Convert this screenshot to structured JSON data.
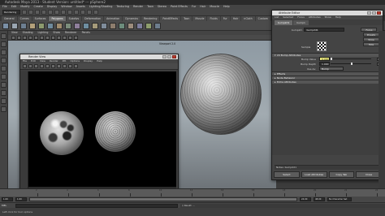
{
  "app": {
    "title": "Autodesk Maya 2013 - Student Version: untitled* --- pSphere2",
    "menus": [
      "File",
      "Edit",
      "Modify",
      "Create",
      "Display",
      "Window",
      "Assets",
      "Lighting/Shading",
      "Texturing",
      "Render",
      "Toon",
      "Stereo",
      "Paint Effects",
      "Fur",
      "Hair",
      "Muscle",
      "Help"
    ]
  },
  "status_line": {
    "mode_selector": "Rendering"
  },
  "shelf": {
    "tabs": [
      "General",
      "Curves",
      "Surfaces",
      "Polygons",
      "Subdivs",
      "Deformation",
      "Animation",
      "Dynamics",
      "Rendering",
      "PaintEffects",
      "Toon",
      "Muscle",
      "Fluids",
      "Fur",
      "Hair",
      "nCloth",
      "Custom"
    ],
    "active_tab": "Polygons",
    "icon_colors": [
      "#7a8fa5",
      "#9aa6b2",
      "#6d7f91",
      "#b3a07a",
      "#8c9a6e",
      "#6f8a9c",
      "#a08c6e",
      "#7b8d7b",
      "#8f7f9b",
      "#6e8ea0",
      "#a59a7a",
      "#7f8c9a",
      "#8d7d6d",
      "#6c8c7c",
      "#9c8c7c",
      "#7d7d9d",
      "#8d9d6d",
      "#6d7d8d"
    ]
  },
  "viewport": {
    "menu": [
      "View",
      "Shading",
      "Lighting",
      "Show",
      "Renderer",
      "Panels"
    ],
    "label": "Viewport 2.0"
  },
  "render_view": {
    "title": "Render View",
    "menu": [
      "File",
      "Edit",
      "View",
      "Render",
      "IPR",
      "Options",
      "Display",
      "Help"
    ],
    "info_line1": "size: 640 x 480  zoom: 1.000      (mental ray)",
    "frame_label": "Frame: 1",
    "render_time_label": "Render Time: 0:01",
    "camera_label": "Camera: persp"
  },
  "attribute_editor": {
    "title": "Attribute Editor",
    "menu": [
      "List",
      "Selected",
      "Focus",
      "Attributes",
      "Show",
      "Help"
    ],
    "tabs": [
      "bump2d1",
      "bump1"
    ],
    "active_tab": "bump2d1",
    "node_type_label": "bump2d:",
    "node_name": "bump2d1",
    "focus_button": "Focus",
    "presets_button": "Presets",
    "show_button": "Show",
    "hide_button": "Hide",
    "sample_label": "Sample",
    "sections": {
      "bump_attributes": "2d Bump Attributes",
      "effects": "Effects",
      "node_behavior": "Node Behavior",
      "extra_attributes": "Extra Attributes"
    },
    "attrs": {
      "bump_value_label": "Bump Value",
      "bump_value": "0.000",
      "bump_depth_label": "Bump Depth",
      "bump_depth": "1.000",
      "use_as_label": "Use As:",
      "use_as_value": "Bump"
    },
    "notes_label": "Notes:  bump2d1",
    "bottom_buttons": [
      "Select",
      "Load Attributes",
      "Copy Tab",
      "Close"
    ]
  },
  "timeline": {
    "ticks": [
      2,
      4,
      6,
      8,
      10,
      12,
      14,
      16,
      18,
      20,
      22,
      24
    ]
  },
  "range_bar": {
    "start": "1.00",
    "start2": "1.00",
    "end": "24.00",
    "end2": "48.00",
    "character_set": "No Character Set"
  },
  "command_line": {
    "language": "MEL",
    "result": "// Result: ..."
  },
  "help_line": {
    "text": "Left click for tool options"
  }
}
